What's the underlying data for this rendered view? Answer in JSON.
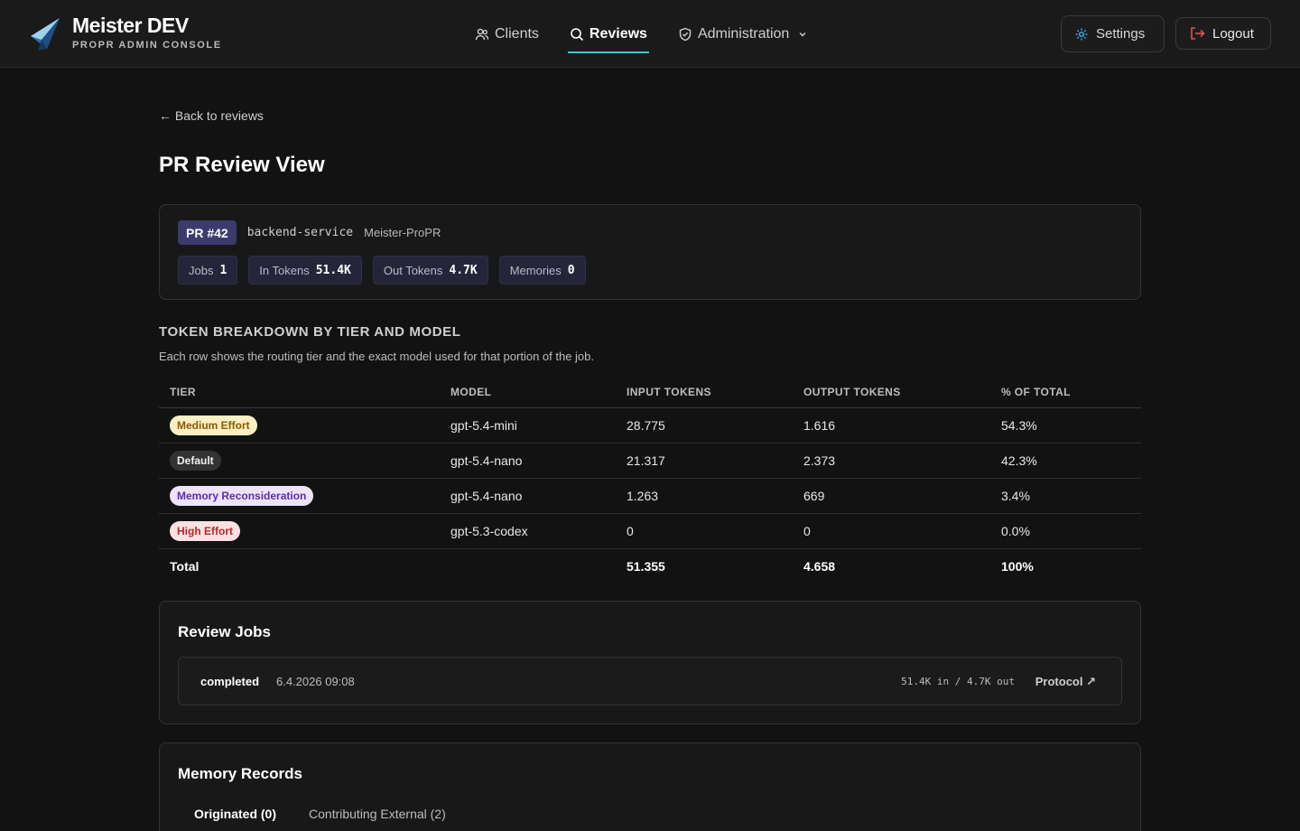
{
  "brand": {
    "title": "Meister DEV",
    "subtitle": "PROPR ADMIN CONSOLE"
  },
  "nav": {
    "clients": "Clients",
    "reviews": "Reviews",
    "administration": "Administration"
  },
  "header": {
    "settings": "Settings",
    "logout": "Logout"
  },
  "colors": {
    "accent": "#3ec6d4",
    "logout_icon": "#e05252",
    "settings_icon": "#3ea8e0"
  },
  "back_link": "← Back to reviews",
  "page_title": "PR Review View",
  "pr": {
    "badge": "PR #42",
    "repo": "backend-service",
    "project": "Meister-ProPR",
    "stats": [
      {
        "label": "Jobs",
        "value": "1"
      },
      {
        "label": "In Tokens",
        "value": "51.4K"
      },
      {
        "label": "Out Tokens",
        "value": "4.7K"
      },
      {
        "label": "Memories",
        "value": "0"
      }
    ]
  },
  "breakdown": {
    "title": "TOKEN BREAKDOWN BY TIER AND MODEL",
    "description": "Each row shows the routing tier and the exact model used for that portion of the job.",
    "columns": [
      "TIER",
      "MODEL",
      "INPUT TOKENS",
      "OUTPUT TOKENS",
      "% OF TOTAL"
    ],
    "rows": [
      {
        "tier": "Medium Effort",
        "tier_bg": "#fdf0c4",
        "tier_fg": "#8a5a00",
        "model": "gpt-5.4-mini",
        "input": "28.775",
        "output": "1.616",
        "pct": "54.3%"
      },
      {
        "tier": "Default",
        "tier_bg": "#333333",
        "tier_fg": "#f0f0f0",
        "model": "gpt-5.4-nano",
        "input": "21.317",
        "output": "2.373",
        "pct": "42.3%"
      },
      {
        "tier": "Memory Reconsideration",
        "tier_bg": "#ede4fb",
        "tier_fg": "#5b2fa8",
        "model": "gpt-5.4-nano",
        "input": "1.263",
        "output": "669",
        "pct": "3.4%"
      },
      {
        "tier": "High Effort",
        "tier_bg": "#fbe1e1",
        "tier_fg": "#b02a2a",
        "model": "gpt-5.3-codex",
        "input": "0",
        "output": "0",
        "pct": "0.0%"
      }
    ],
    "total": {
      "label": "Total",
      "input": "51.355",
      "output": "4.658",
      "pct": "100%"
    }
  },
  "jobs": {
    "title": "Review Jobs",
    "items": [
      {
        "status": "completed",
        "date": "6.4.2026 09:08",
        "tokens": "51.4K in / 4.7K out",
        "link": "Protocol ↗"
      }
    ]
  },
  "memory": {
    "title": "Memory Records",
    "tabs": [
      "Originated (0)",
      "Contributing External (2)"
    ]
  }
}
